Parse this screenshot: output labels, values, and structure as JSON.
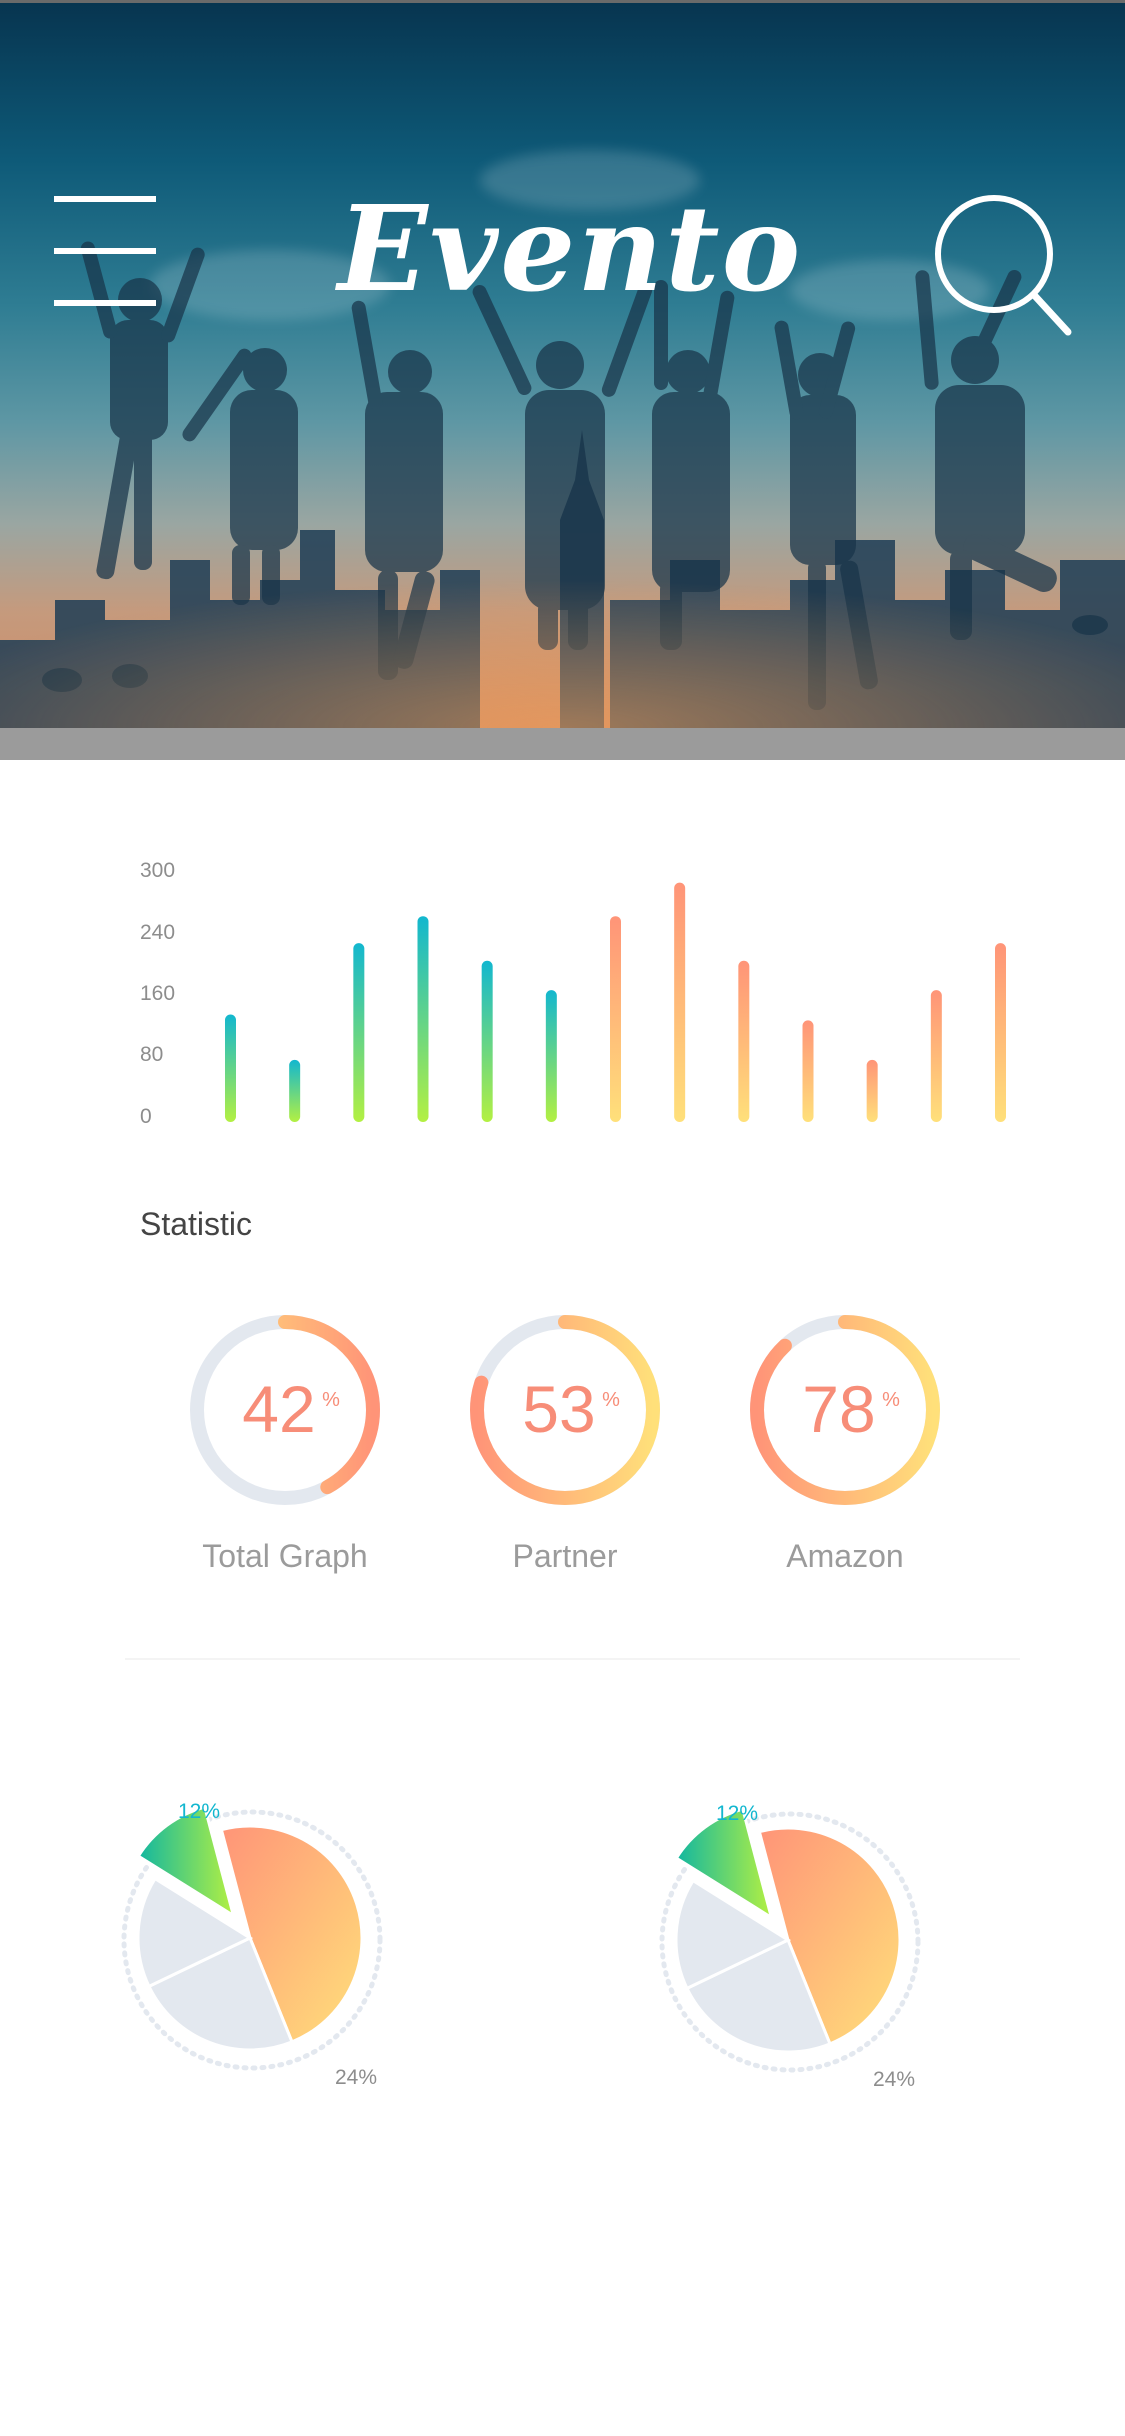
{
  "header": {
    "title": "Evento",
    "menu_icon": "hamburger-menu-icon",
    "search_icon": "search-icon"
  },
  "colors": {
    "teal": "#12b7cf",
    "lime": "#b3f042",
    "coral": "#ff9478",
    "yellow": "#ffe07a",
    "track": "#e3e8ef",
    "stat_text": "#f78d78",
    "pie_teal": "#1bb89c"
  },
  "chart_data": [
    {
      "type": "bar",
      "title": "",
      "xlabel": "",
      "ylabel": "",
      "y_ticks": [
        "300",
        "240",
        "160",
        "80",
        "0"
      ],
      "ylim": [
        0,
        300
      ],
      "grid": false,
      "values": [
        128,
        74,
        213,
        245,
        192,
        157,
        245,
        285,
        192,
        121,
        74,
        157,
        213
      ],
      "bar_color_groups": [
        "teal-lime",
        "teal-lime",
        "teal-lime",
        "teal-lime",
        "teal-lime",
        "teal-lime",
        "coral-yellow",
        "coral-yellow",
        "coral-yellow",
        "coral-yellow",
        "coral-yellow",
        "coral-yellow",
        "coral-yellow"
      ]
    },
    {
      "type": "pie",
      "callouts": [
        "12%",
        "24%"
      ],
      "slices": [
        {
          "value": 12,
          "color": "teal",
          "exploded": true
        },
        {
          "value": 48,
          "color": "coral-yellow"
        },
        {
          "value": 24,
          "color": "gray"
        },
        {
          "value": 16,
          "color": "gray"
        }
      ]
    },
    {
      "type": "pie",
      "callouts": [
        "12%",
        "24%"
      ],
      "slices": [
        {
          "value": 12,
          "color": "teal",
          "exploded": true
        },
        {
          "value": 48,
          "color": "coral-yellow"
        },
        {
          "value": 24,
          "color": "gray"
        },
        {
          "value": 16,
          "color": "gray"
        }
      ]
    }
  ],
  "statistic": {
    "title": "Statistic",
    "items": [
      {
        "value": "42",
        "unit": "%",
        "label": "Total Graph",
        "progress": 0.42
      },
      {
        "value": "53",
        "unit": "%",
        "label": "Partner",
        "progress": 0.8
      },
      {
        "value": "78",
        "unit": "%",
        "label": "Amazon",
        "progress": 0.88
      }
    ]
  }
}
